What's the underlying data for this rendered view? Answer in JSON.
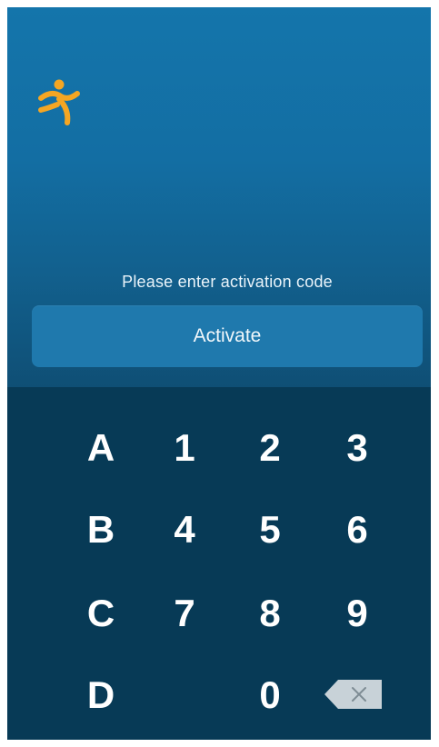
{
  "colors": {
    "header_top": "#1475ab",
    "header_bottom": "#0f4f75",
    "keypad_bg": "#073a56",
    "button_bg": "#1f79ad",
    "logo_orange": "#f5a623",
    "backspace_gray": "#c8d2d8"
  },
  "logo": {
    "icon": "running-person-logo"
  },
  "prompt": "Please enter activation code",
  "activate_label": "Activate",
  "keypad": {
    "rows": [
      [
        "A",
        "1",
        "2",
        "3"
      ],
      [
        "B",
        "4",
        "5",
        "6"
      ],
      [
        "C",
        "7",
        "8",
        "9"
      ],
      [
        "D",
        "",
        "0",
        "backspace"
      ]
    ]
  }
}
